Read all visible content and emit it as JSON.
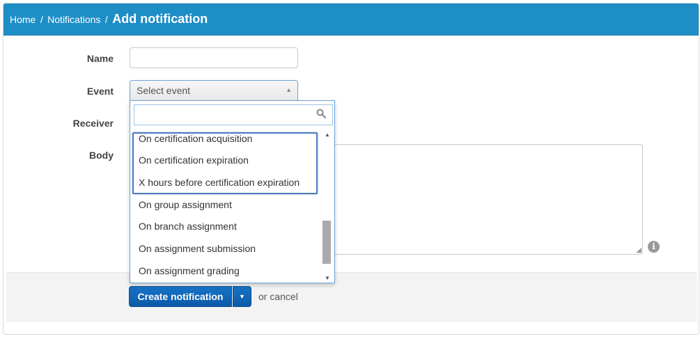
{
  "breadcrumb": {
    "home": "Home",
    "separator": "/",
    "notifications": "Notifications",
    "current": "Add notification"
  },
  "form": {
    "name_label": "Name",
    "name_value": "",
    "event_label": "Event",
    "event_value": "Select event",
    "receiver_label": "Receiver",
    "body_label": "Body",
    "body_value": ""
  },
  "event_dropdown": {
    "search_value": "",
    "items": [
      "On certification acquisition",
      "On certification expiration",
      "X hours before certification expiration",
      "On group assignment",
      "On branch assignment",
      "On assignment submission",
      "On assignment grading"
    ]
  },
  "footer": {
    "create_label": "Create notification",
    "or_text": "or",
    "cancel_label": "cancel"
  },
  "icons": {
    "search": "search-icon",
    "info": "info-icon",
    "caret": "caret-down-icon"
  },
  "colors": {
    "header": "#1e8ec6",
    "primary_button": "#1773c6",
    "highlight_border": "#4f7bc0"
  }
}
